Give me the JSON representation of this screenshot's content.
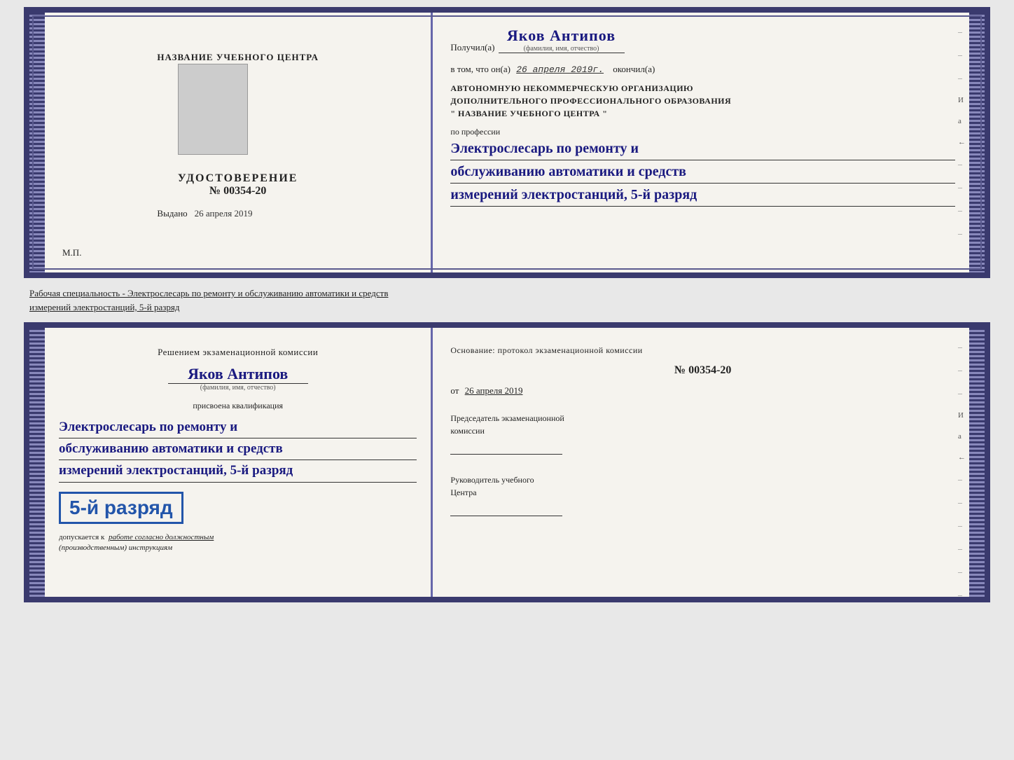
{
  "background_color": "#e8e8e8",
  "top_cert": {
    "left": {
      "org_name": "НАЗВАНИЕ УЧЕБНОГО ЦЕНТРА",
      "cert_label": "УДОСТОВЕРЕНИЕ",
      "cert_number": "№ 00354-20",
      "issued_prefix": "Выдано",
      "issued_date": "26 апреля 2019",
      "mp_label": "М.П."
    },
    "right": {
      "recipient_prefix": "Получил(а)",
      "recipient_name": "Яков Антипов",
      "fio_hint": "(фамилия, имя, отчество)",
      "date_prefix": "в том, что он(а)",
      "date_value": "26 апреля 2019г.",
      "date_suffix": "окончил(а)",
      "org_block_line1": "АВТОНОМНУЮ НЕКОММЕРЧЕСКУЮ ОРГАНИЗАЦИЮ",
      "org_block_line2": "ДОПОЛНИТЕЛЬНОГО ПРОФЕССИОНАЛЬНОГО ОБРАЗОВАНИЯ",
      "org_block_line3": "\"   НАЗВАНИЕ УЧЕБНОГО ЦЕНТРА   \"",
      "profession_prefix": "по профессии",
      "profession_line1": "Электрослесарь по ремонту и",
      "profession_line2": "обслуживанию автоматики и средств",
      "profession_line3": "измерений электростанций, 5-й разряд"
    }
  },
  "middle_text": "Рабочая специальность - Электрослесарь по ремонту и обслуживанию автоматики и средств\nизмерений электростанций, 5-й разряд",
  "bottom_cert": {
    "left": {
      "commission_text": "Решением экзаменационной комиссии",
      "person_name": "Яков Антипов",
      "fio_hint": "(фамилия, имя, отчество)",
      "qualification_prefix": "присвоена квалификация",
      "qual_line1": "Электрослесарь по ремонту и",
      "qual_line2": "обслуживанию автоматики и средств",
      "qual_line3": "измерений электростанций, 5-й разряд",
      "grade_text": "5-й разряд",
      "допускается_prefix": "допускается к",
      "допускается_suffix": "работе согласно должностным",
      "инструкции": "(производственным) инструкциям"
    },
    "right": {
      "basis_label": "Основание: протокол экзаменационной комиссии",
      "number_label": "№  00354-20",
      "date_prefix": "от",
      "date_value": "26 апреля 2019",
      "chairman_label": "Председатель экзаменационной",
      "commission_label": "комиссии",
      "head_line1": "Руководитель учебного",
      "head_line2": "Центра"
    }
  }
}
